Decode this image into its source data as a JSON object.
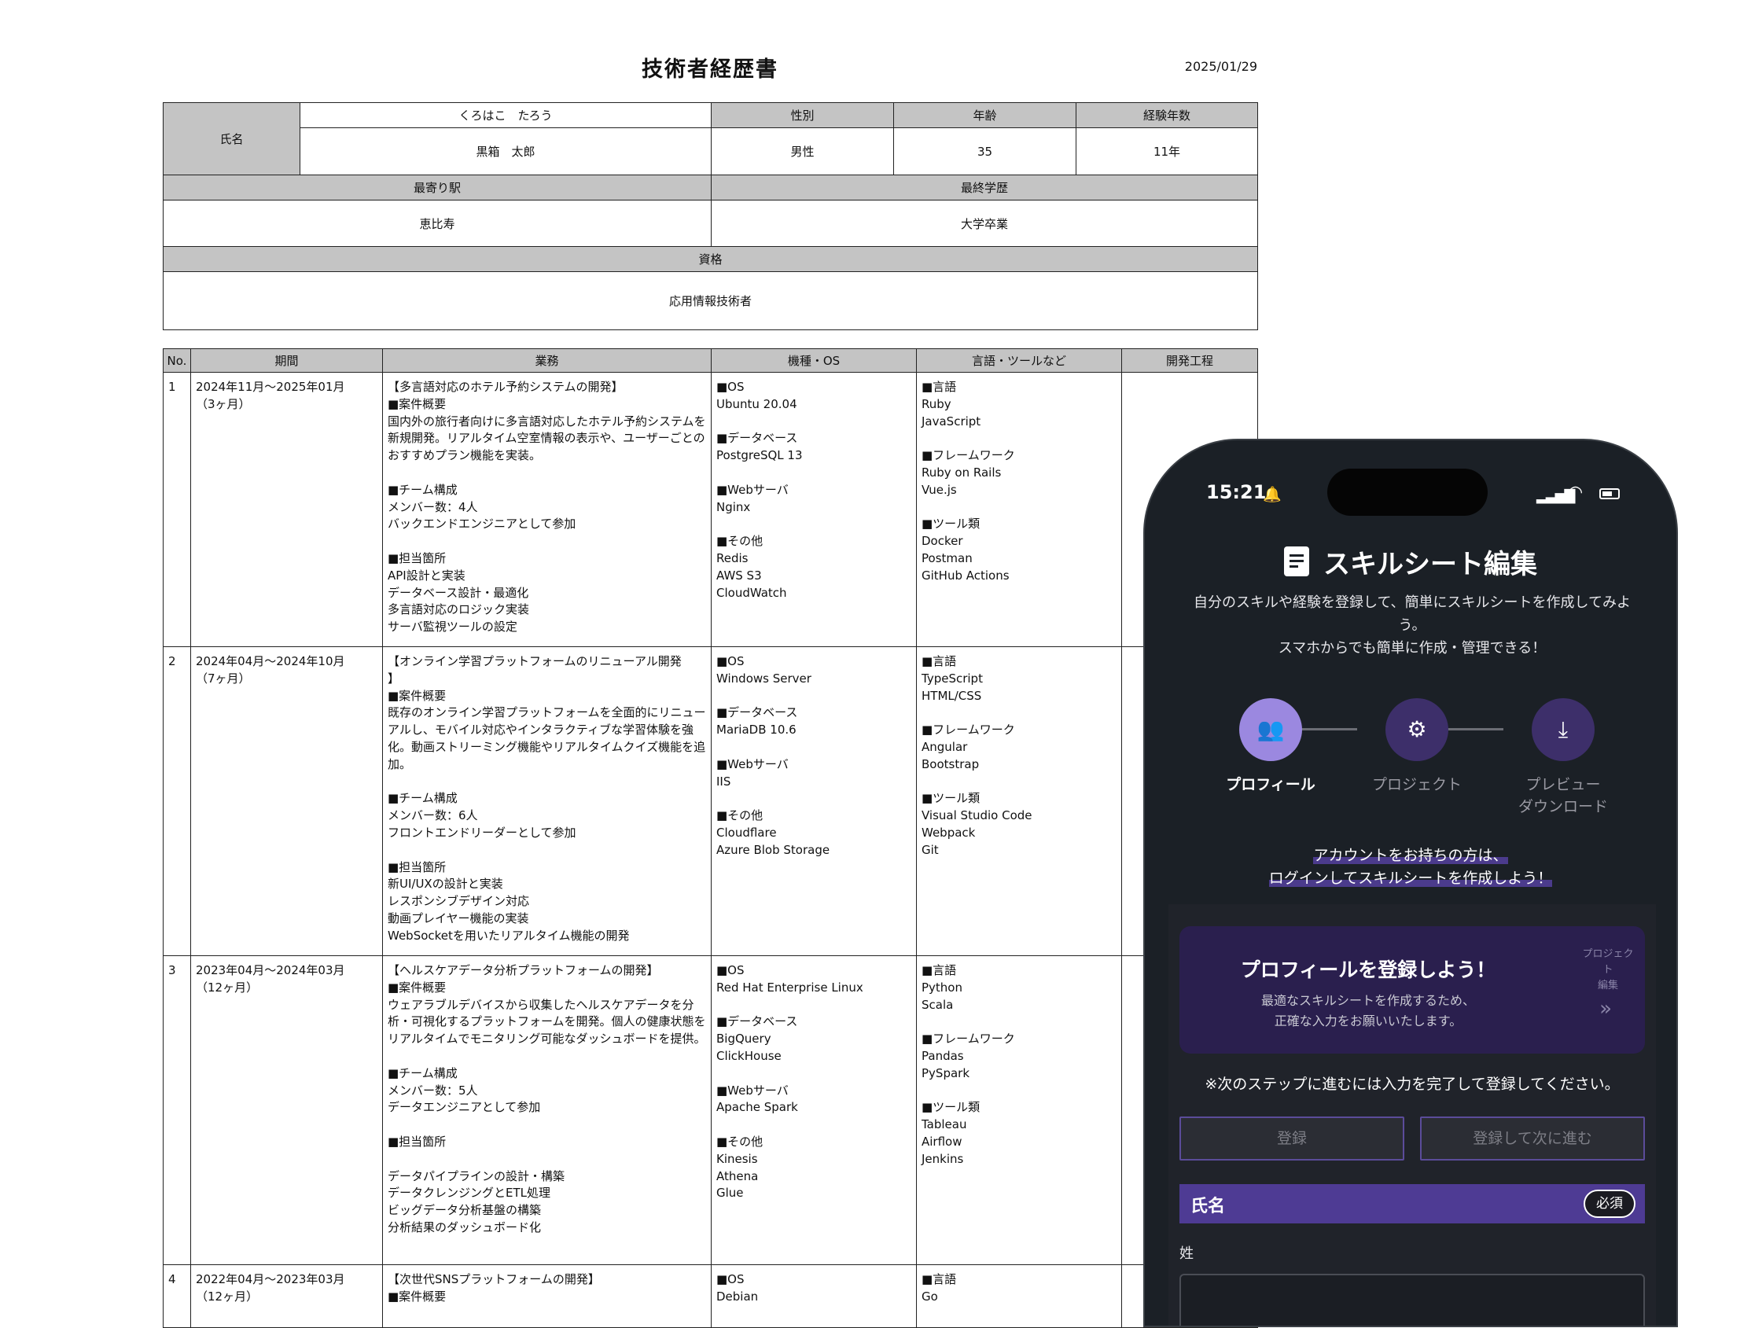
{
  "document": {
    "title": "技術者経歴書",
    "date": "2025/01/29",
    "labels": {
      "name": "氏名",
      "gender": "性別",
      "age": "年齢",
      "experience": "経験年数",
      "station": "最寄り駅",
      "education": "最終学歴",
      "qualification": "資格"
    },
    "values": {
      "kana": "くろはこ　たろう",
      "name": "黒箱　太郎",
      "gender": "男性",
      "age": "35",
      "experience": "11年",
      "station": "恵比寿",
      "education": "大学卒業",
      "qualification": "応用情報技術者"
    },
    "columns": [
      "No.",
      "期間",
      "業務",
      "機種・OS",
      "言語・ツールなど",
      "開発工程"
    ],
    "projects": [
      {
        "no": "1",
        "period": "2024年11月〜2025年01月\n（3ヶ月）",
        "work": "【多言語対応のホテル予約システムの開発】\n■案件概要\n国内外の旅行者向けに多言語対応したホテル予約システムを新規開発。リアルタイム空室情報の表示や、ユーザーごとのおすすめプラン機能を実装。\n\n■チーム構成\nメンバー数：4人\nバックエンドエンジニアとして参加\n\n■担当箇所\nAPI設計と実装\nデータベース設計・最適化\n多言語対応のロジック実装\nサーバ監視ツールの設定",
        "os": "■OS\nUbuntu 20.04\n\n■データベース\nPostgreSQL 13\n\n■Webサーバ\nNginx\n\n■その他\nRedis\nAWS S3\nCloudWatch",
        "tools": "■言語\nRuby\nJavaScript\n\n■フレームワーク\nRuby on Rails\nVue.js\n\n■ツール類\nDocker\nPostman\nGitHub Actions",
        "process": ""
      },
      {
        "no": "2",
        "period": "2024年04月〜2024年10月\n（7ヶ月）",
        "work": "【オンライン学習プラットフォームのリニューアル開発\n】\n■案件概要\n既存のオンライン学習プラットフォームを全面的にリニューアルし、モバイル対応やインタラクティブな学習体験を強化。動画ストリーミング機能やリアルタイムクイズ機能を追加。\n\n■チーム構成\nメンバー数：6人\nフロントエンドリーダーとして参加\n\n■担当箇所\n新UI/UXの設計と実装\nレスポンシブデザイン対応\n動画プレイヤー機能の実装\nWebSocketを用いたリアルタイム機能の開発",
        "os": "■OS\nWindows Server\n\n■データベース\nMariaDB 10.6\n\n■Webサーバ\nIIS\n\n■その他\nCloudflare\nAzure Blob Storage",
        "tools": "■言語\nTypeScript\nHTML/CSS\n\n■フレームワーク\nAngular\nBootstrap\n\n■ツール類\nVisual Studio Code\nWebpack\nGit",
        "process": ""
      },
      {
        "no": "3",
        "period": "2023年04月〜2024年03月\n（12ヶ月）",
        "work": "【ヘルスケアデータ分析プラットフォームの開発】\n■案件概要\nウェアラブルデバイスから収集したヘルスケアデータを分析・可視化するプラットフォームを開発。個人の健康状態をリアルタイムでモニタリング可能なダッシュボードを提供。\n\n■チーム構成\nメンバー数：5人\nデータエンジニアとして参加\n\n■担当箇所\n\nデータパイプラインの設計・構築\nデータクレンジングとETL処理\nビッグデータ分析基盤の構築\n分析結果のダッシュボード化",
        "os": "■OS\nRed Hat Enterprise Linux\n\n■データベース\nBigQuery\nClickHouse\n\n■Webサーバ\nApache Spark\n\n■その他\nKinesis\nAthena\nGlue",
        "tools": "■言語\nPython\nScala\n\n■フレームワーク\nPandas\nPySpark\n\n■ツール類\nTableau\nAirflow\nJenkins",
        "process": ""
      },
      {
        "no": "4",
        "period": "2022年04月〜2023年03月\n（12ヶ月）",
        "work": "【次世代SNSプラットフォームの開発】\n■案件概要",
        "os": "■OS\nDebian",
        "tools": "■言語\nGo",
        "process": ""
      }
    ]
  },
  "phone": {
    "time": "15:21",
    "title": "スキルシート編集",
    "desc_line1": "自分のスキルや経験を登録して、簡単にスキルシートを作成してみよ",
    "desc_line2": "う。",
    "desc_line3": "スマホからでも簡単に作成・管理できる！",
    "steps": [
      {
        "label": "プロフィール",
        "label2": ""
      },
      {
        "label": "プロジェクト",
        "label2": ""
      },
      {
        "label": "プレビュー",
        "label2": "ダウンロード"
      }
    ],
    "login_line1": "アカウントをお持ちの方は、",
    "login_line2": "ログインしてスキルシートを作成しよう！",
    "card_title": "プロフィールを登録しよう！",
    "card_sub1": "最適なスキルシートを作成するため、",
    "card_sub2": "正確な入力をお願いいたします。",
    "card_next": "プロジェクト\n編集",
    "note": "※次のステップに進むには入力を完了して登録してください。",
    "btn_register": "登録",
    "btn_register_next": "登録して次に進む",
    "field_label": "氏名",
    "required": "必須",
    "sei_label": "姓",
    "colors": {
      "background": "#1b2026",
      "accent": "#4e3b94",
      "active_step": "#9b88e0"
    }
  }
}
